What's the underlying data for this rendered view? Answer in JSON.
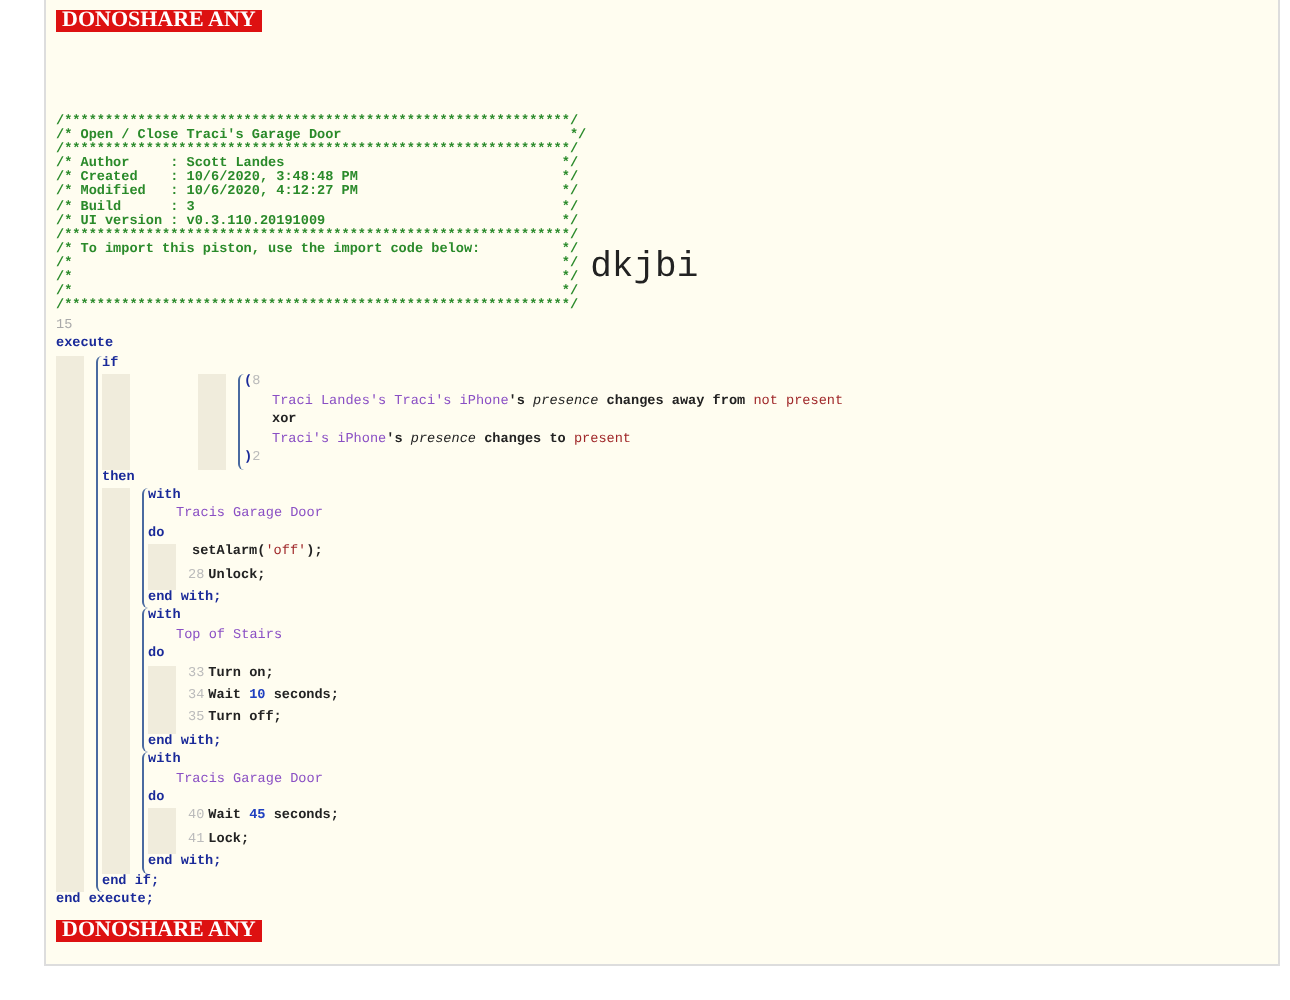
{
  "banner_top": "DONOSHARE ANY",
  "header": [
    "/**************************************************************/",
    "/* Open / Close Traci's Garage Door                            */",
    "/**************************************************************/",
    "/* Author     : Scott Landes                                  */",
    "/* Created    : 10/6/2020, 3:48:48 PM                         */",
    "/* Modified   : 10/6/2020, 4:12:27 PM                         */",
    "/* Build      : 3                                             */",
    "/* UI version : v0.3.110.20191009                             */",
    "/**************************************************************/",
    "/* To import this piston, use the import code below:          */",
    "/*                                                            */",
    "/*                                                            */",
    "/*                                                            */",
    "/**************************************************************/"
  ],
  "import_code": "dkjbi",
  "top_line_number": "15",
  "program": {
    "keyword": "execute",
    "end": "end execute;",
    "if": {
      "keyword": "if",
      "open": "(",
      "open_number": "8",
      "close": ")",
      "close_number": "2",
      "conditions": [
        [
          {
            "kind": "device",
            "text": "Traci Landes's Traci's iPhone"
          },
          {
            "kind": "plain",
            "text": "'s "
          },
          {
            "kind": "attr",
            "text": "presence"
          },
          {
            "kind": "plain",
            "text": " changes away from "
          },
          {
            "kind": "value",
            "text": "not present"
          }
        ],
        [
          {
            "kind": "plain",
            "text": "xor"
          }
        ],
        [
          {
            "kind": "device",
            "text": "Traci's iPhone"
          },
          {
            "kind": "plain",
            "text": "'s "
          },
          {
            "kind": "attr",
            "text": "presence"
          },
          {
            "kind": "plain",
            "text": " changes to "
          },
          {
            "kind": "value",
            "text": "present"
          }
        ]
      ],
      "then": "then",
      "blocks": [
        {
          "with": "with",
          "device": "Tracis Garage Door",
          "do": "do",
          "end": "end with;",
          "statements": [
            {
              "tokens": [
                {
                  "kind": "plain",
                  "text": "setAlarm("
                },
                {
                  "kind": "value",
                  "text": "'off'"
                },
                {
                  "kind": "plain",
                  "text": ");"
                }
              ]
            },
            {
              "number": "28",
              "tokens": [
                {
                  "kind": "plain",
                  "text": "Unlock;"
                }
              ]
            }
          ]
        },
        {
          "with": "with",
          "device": "Top of Stairs",
          "do": "do",
          "end": "end with;",
          "statements": [
            {
              "number": "33",
              "tokens": [
                {
                  "kind": "plain",
                  "text": "Turn on;"
                }
              ]
            },
            {
              "number": "34",
              "tokens": [
                {
                  "kind": "plain",
                  "text": "Wait "
                },
                {
                  "kind": "number",
                  "text": "10"
                },
                {
                  "kind": "plain",
                  "text": " seconds;"
                }
              ]
            },
            {
              "number": "35",
              "tokens": [
                {
                  "kind": "plain",
                  "text": "Turn off;"
                }
              ]
            }
          ]
        },
        {
          "with": "with",
          "device": "Tracis Garage Door",
          "do": "do",
          "end": "end with;",
          "statements": [
            {
              "number": "40",
              "tokens": [
                {
                  "kind": "plain",
                  "text": "Wait "
                },
                {
                  "kind": "number",
                  "text": "45"
                },
                {
                  "kind": "plain",
                  "text": " seconds;"
                }
              ]
            },
            {
              "number": "41",
              "tokens": [
                {
                  "kind": "plain",
                  "text": "Lock;"
                }
              ]
            }
          ]
        }
      ],
      "end": "end if;"
    }
  },
  "banner_bottom": "DONOSHARE ANY"
}
